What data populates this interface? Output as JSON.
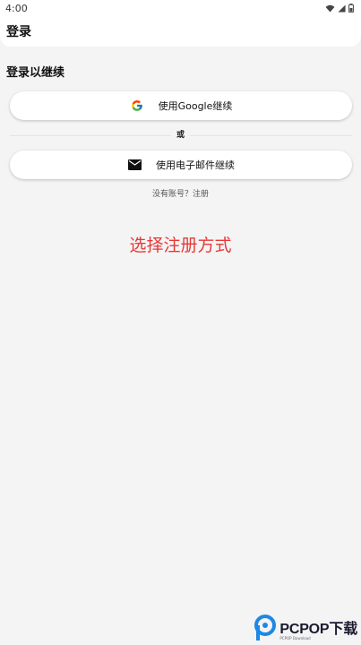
{
  "status_bar": {
    "time": "4:00"
  },
  "app_bar": {
    "title": "登录"
  },
  "login": {
    "subtitle": "登录以继续",
    "google_button": "使用Google继续",
    "divider": "或",
    "email_button": "使用电子邮件继续",
    "signup_text": "没有账号？注册"
  },
  "caption": "选择注册方式",
  "watermark": {
    "brand": "PCPOP下载",
    "sub": "PCPOP Download"
  },
  "colors": {
    "background": "#f4f4f5",
    "caption_red": "#e53935",
    "watermark_blue": "#1e88e5"
  }
}
